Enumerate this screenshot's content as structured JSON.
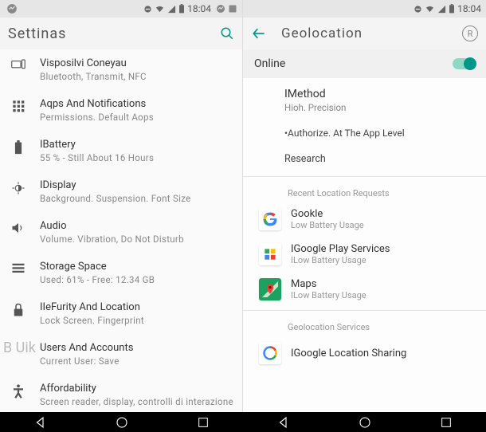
{
  "status": {
    "time": "18:04"
  },
  "left": {
    "title": "Settinas",
    "watermark": "B Uik",
    "items": [
      {
        "title": "Visposilvi Coneyau",
        "sub": "Bluetooth, Transmit, NFC"
      },
      {
        "title": "Aqps And Notifications",
        "sub": "Permissions. Default Aops"
      },
      {
        "title": "IBattery",
        "sub": "55 % - Still About 16 Hours"
      },
      {
        "title": "IDisplay",
        "sub": "Background. Suspension. Font Size"
      },
      {
        "title": "Audio",
        "sub": "Volume. Vibration, Do Not Disturb"
      },
      {
        "title": "Storage Space",
        "sub": "Used: 61% - Free: 12.34 GB"
      },
      {
        "title": "IIeFurity And Location",
        "sub": "Lock Screen. Fingerprint"
      },
      {
        "title": "Users And Accounts",
        "sub": "Current User: Save"
      },
      {
        "title": "Affordability",
        "sub": "Screen reader, display, controlli di interazione"
      }
    ]
  },
  "right": {
    "title": "Geolocation",
    "online_label": "Online",
    "method": {
      "title": "IMethod",
      "sub": "Hioh. Precision"
    },
    "authorize": "•Authorize. At The App Level",
    "research": "Research",
    "recent_header": "Recent Location Requests",
    "apps": [
      {
        "name": "Gookle",
        "sub": "Low Battery Usage"
      },
      {
        "name": "IGoogle Play Services",
        "sub": "ILow Battery Usage"
      },
      {
        "name": "Maps",
        "sub": "ILow Battery Usage"
      }
    ],
    "services_header": "Geolocation Services",
    "sharing": "IGoogle Location Sharing"
  }
}
